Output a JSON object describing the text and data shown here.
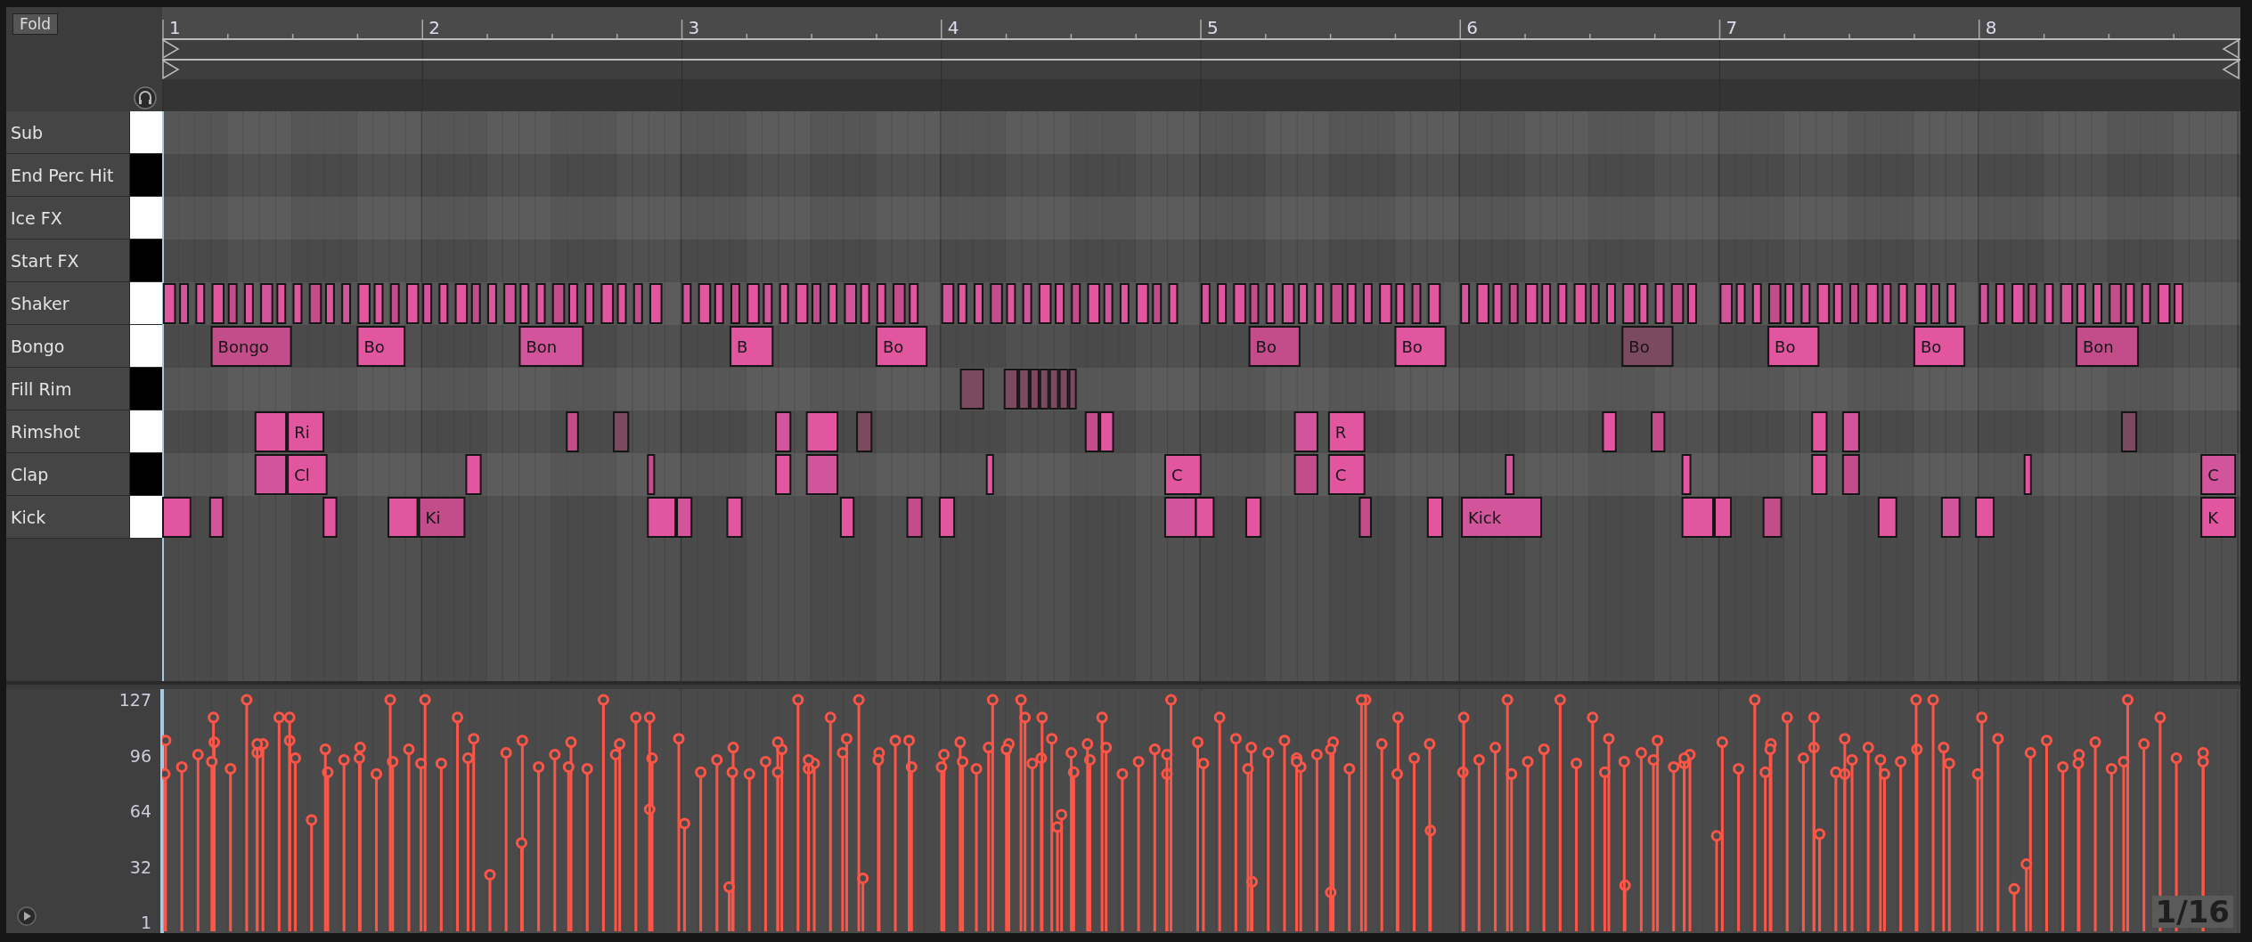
{
  "fold_button": "Fold",
  "ruler": {
    "bars": [
      "1",
      "2",
      "3",
      "4",
      "5",
      "6",
      "7",
      "8"
    ]
  },
  "rows": [
    {
      "name": "Sub",
      "color": "#ffffff"
    },
    {
      "name": "End Perc Hit",
      "color": "#000000"
    },
    {
      "name": "Ice FX",
      "color": "#ffffff"
    },
    {
      "name": "Start FX",
      "color": "#000000"
    },
    {
      "name": "Shaker",
      "color": "#ffffff"
    },
    {
      "name": "Bongo",
      "color": "#ffffff",
      "labels": [
        "Bongo",
        "Bo",
        "Bon",
        "B",
        "Bo",
        "Bo",
        "Bo",
        "Bo",
        "Bo",
        "Bo",
        "Bon"
      ]
    },
    {
      "name": "Fill Rim",
      "color": "#000000"
    },
    {
      "name": "Rimshot",
      "color": "#ffffff",
      "labels": [
        "Ri",
        "R"
      ]
    },
    {
      "name": "Clap",
      "color": "#000000",
      "labels": [
        "Cl",
        "C",
        "C",
        "C"
      ]
    },
    {
      "name": "Kick",
      "color": "#ffffff",
      "labels": [
        "Ki",
        "Kick",
        "K"
      ]
    }
  ],
  "velocity": {
    "ticks": [
      "127",
      "96",
      "64",
      "32",
      "1"
    ],
    "grid": "1/16"
  }
}
